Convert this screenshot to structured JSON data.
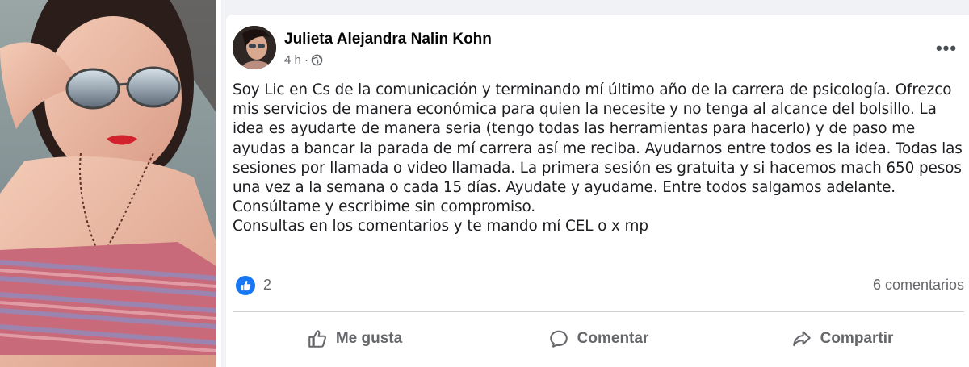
{
  "post": {
    "author": "Julieta Alejandra Nalin Kohn",
    "time": "4 h ·",
    "more_label": "•••",
    "text_lines": [
      "Soy Lic en Cs de la comunicación y terminando mí último año de la carrera de psicología. Ofrezco",
      "mis servicios de manera económica para quien la necesite y no tenga al alcance del bolsillo. La",
      "idea es ayudarte de manera seria (tengo todas las herramientas para hacerlo) y de paso me",
      "ayudas a bancar la parada de mí carrera así me reciba. Ayudarnos entre todos es la idea. Todas las",
      "sesiones por llamada o video llamada. La primera sesión es gratuita y si hacemos mach 650 pesos",
      "una vez a la semana o cada 15 días. Ayudate y ayudame. Entre todos salgamos adelante.",
      "Consúltame y escribime sin compromiso.",
      "Consultas en los comentarios y te mando mí CEL o x mp"
    ],
    "reactions_count": "2",
    "comments_count": "6 comentarios"
  },
  "actions": {
    "like": "Me gusta",
    "comment": "Comentar",
    "share": "Compartir"
  },
  "colors": {
    "brand_blue": "#1877f2",
    "secondary_text": "#65676b",
    "background": "#f0f2f5"
  },
  "icons": [
    "globe-icon",
    "more-icon",
    "like-reaction-icon",
    "thumbs-up-icon",
    "comment-icon",
    "share-icon"
  ]
}
